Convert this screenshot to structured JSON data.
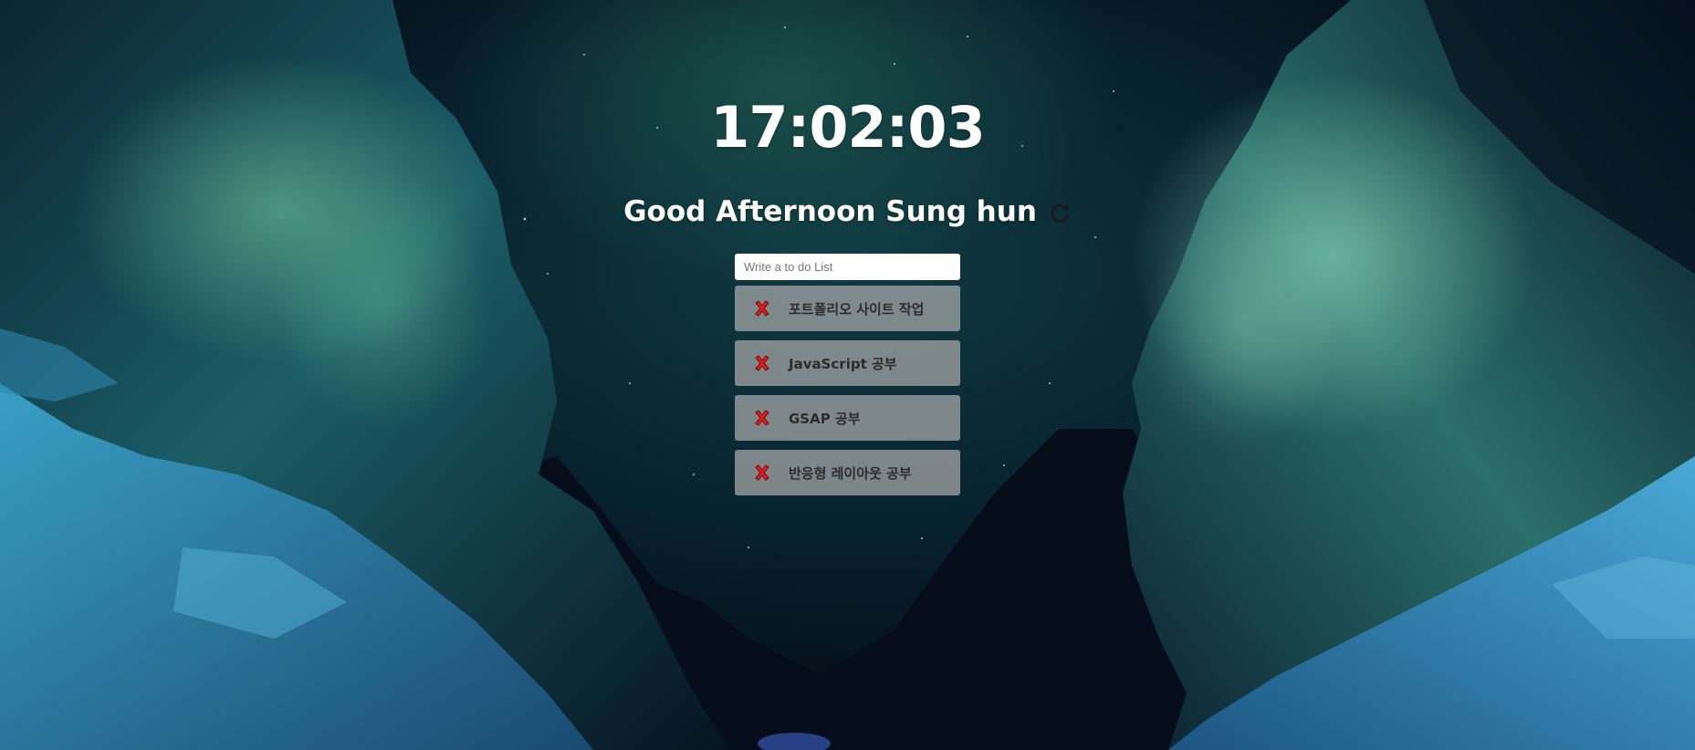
{
  "clock": {
    "time": "17:02:03"
  },
  "greeting": {
    "text": "Good Afternoon Sung hun",
    "refresh_icon": "refresh-icon"
  },
  "todo": {
    "input_placeholder": "Write a to do List",
    "input_value": "",
    "delete_icon": "red-x-icon",
    "items": [
      {
        "label": "포트폴리오 사이트 작업"
      },
      {
        "label": "JavaScript 공부"
      },
      {
        "label": "GSAP 공부"
      },
      {
        "label": "반응형 레이아웃 공부"
      }
    ]
  },
  "colors": {
    "text": "#ffffff",
    "item_bg": "#aaaaaa",
    "delete_red": "#e02020"
  }
}
